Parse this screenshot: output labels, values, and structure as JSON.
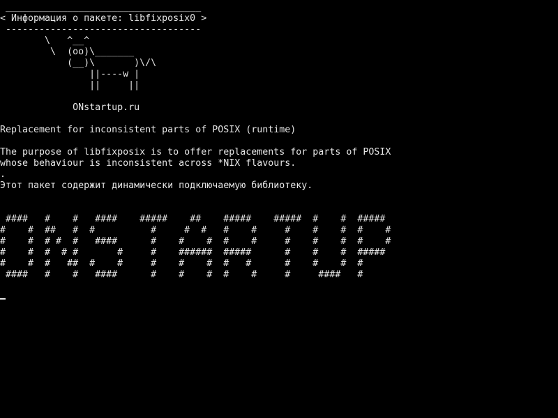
{
  "terminal": {
    "colors": {
      "background": "#000000",
      "foreground": "#e6e6e6"
    },
    "banner": {
      "border_top": " ___________________________________",
      "title": "< Информация о пакете: libfixposix0 >",
      "border_bottom": " -----------------------------------"
    },
    "cow": [
      "        \\   ^__^",
      "         \\  (oo)\\_______",
      "            (__)\\       )\\/\\",
      "                ||----w |",
      "                ||     ||"
    ],
    "site": "             ONstartup.ru",
    "summary": "Replacement for inconsistent parts of POSIX (runtime)",
    "description": [
      "The purpose of libfixposix is to offer replacements for parts of POSIX",
      "whose behaviour is inconsistent across *NIX flavours.",
      ".",
      "Этот пакет содержит динамически подключаемую библиотеку."
    ],
    "ascii_art": [
      " ####   #    #   ####    #####    ##    #####    #####  #    #  #####",
      "#    #  ##   #  #          #     #  #   #    #     #    #    #  #    #",
      "#    #  # #  #   ####      #    #    #  #    #     #    #    #  #    #",
      "#    #  #  # #       #     #    ######  #####      #    #    #  #####",
      "#    #  #   ##  #    #     #    #    #  #   #      #    #    #  #",
      " ####   #    #   ####      #    #    #  #    #     #     ####   #"
    ]
  }
}
